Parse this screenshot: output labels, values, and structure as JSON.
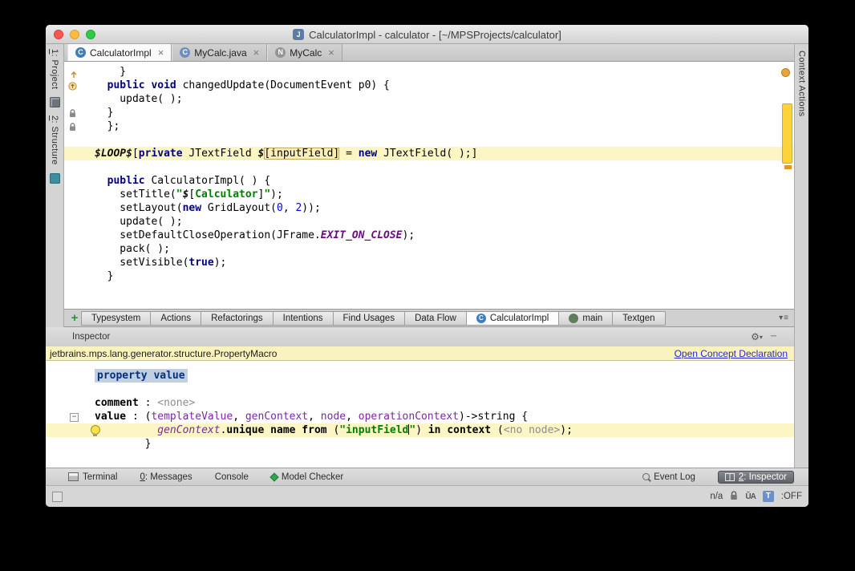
{
  "window": {
    "title": "CalculatorImpl - calculator - [~/MPSProjects/calculator]",
    "title_icon_letter": "J"
  },
  "left_stripe": {
    "items": [
      {
        "num": "1",
        "rest": ": Project"
      },
      {
        "num": "2",
        "rest": ": Structure"
      }
    ]
  },
  "right_stripe": {
    "label": "Context Actions"
  },
  "editor_tabs": [
    {
      "label": "CalculatorImpl",
      "icon": "C",
      "icon_color": "#3f7dc0",
      "icon_name": "concept-icon",
      "active": true,
      "close": "×"
    },
    {
      "label": "MyCalc.java",
      "icon": "C",
      "icon_color": "#6e8fc0",
      "icon_name": "java-class-icon",
      "active": false,
      "close": "×"
    },
    {
      "label": "MyCalc",
      "icon": "N",
      "icon_color": "#949494",
      "icon_name": "node-icon",
      "active": false,
      "close": "×"
    }
  ],
  "editor": {
    "lines": [
      {
        "tokens": [
          [
            "    }",
            "pl"
          ]
        ]
      },
      {
        "tokens": [
          [
            "  ",
            "pl"
          ],
          [
            "public",
            "kw"
          ],
          [
            " ",
            "pl"
          ],
          [
            "void",
            "kw"
          ],
          [
            " changedUpdate(DocumentEvent p0) {",
            "pl"
          ]
        ]
      },
      {
        "tokens": [
          [
            "    update( );",
            "pl"
          ]
        ]
      },
      {
        "tokens": [
          [
            "  }",
            "pl"
          ]
        ]
      },
      {
        "tokens": [
          [
            "  };",
            "pl"
          ]
        ]
      },
      {
        "tokens": []
      },
      {
        "hl": true,
        "tokens": [
          [
            "$LOOP$",
            "macro"
          ],
          [
            "[",
            "pl"
          ],
          [
            "private",
            "kw"
          ],
          [
            " JTextField ",
            "pl"
          ],
          [
            "$",
            "macro"
          ],
          [
            "[inputField]",
            "cell"
          ],
          [
            " = ",
            "pl"
          ],
          [
            "new",
            "kw"
          ],
          [
            " JTextField( );",
            "pl"
          ],
          [
            "]",
            "pl"
          ]
        ]
      },
      {
        "tokens": []
      },
      {
        "tokens": [
          [
            "  ",
            "pl"
          ],
          [
            "public",
            "kw"
          ],
          [
            " CalculatorImpl( ) {",
            "pl"
          ]
        ]
      },
      {
        "tokens": [
          [
            "    setTitle(",
            "pl"
          ],
          [
            "\"",
            "str"
          ],
          [
            "$",
            "macro"
          ],
          [
            "[",
            "pl"
          ],
          [
            "Calculator",
            "str"
          ],
          [
            "]",
            "pl"
          ],
          [
            "\"",
            "str"
          ],
          [
            ");",
            "pl"
          ]
        ]
      },
      {
        "tokens": [
          [
            "    setLayout(",
            "pl"
          ],
          [
            "new",
            "kw"
          ],
          [
            " GridLayout(",
            "pl"
          ],
          [
            "0",
            "num"
          ],
          [
            ", ",
            "pl"
          ],
          [
            "2",
            "num"
          ],
          [
            "));",
            "pl"
          ]
        ]
      },
      {
        "tokens": [
          [
            "    update( );",
            "pl"
          ]
        ]
      },
      {
        "tokens": [
          [
            "    setDefaultCloseOperation(JFrame.",
            "pl"
          ],
          [
            "EXIT_ON_CLOSE",
            "const"
          ],
          [
            ");",
            "pl"
          ]
        ]
      },
      {
        "tokens": [
          [
            "    pack( );",
            "pl"
          ]
        ]
      },
      {
        "tokens": [
          [
            "    setVisible(",
            "pl"
          ],
          [
            "true",
            "kw"
          ],
          [
            ");",
            "pl"
          ]
        ]
      },
      {
        "tokens": [
          [
            "  }",
            "pl"
          ]
        ]
      }
    ]
  },
  "bottom_tabs": {
    "add_label": "+",
    "aspect_tabs": [
      "Typesystem",
      "Actions",
      "Refactorings",
      "Intentions",
      "Find Usages",
      "Data Flow"
    ],
    "file_tabs": [
      {
        "label": "CalculatorImpl",
        "icon": "C",
        "icon_color": "#3f7dc0",
        "active": true
      },
      {
        "label": "main",
        "icon": "",
        "icon_color": "#5d7d5d",
        "active": false
      },
      {
        "label": "Textgen",
        "active": false
      }
    ]
  },
  "inspector": {
    "title": "Inspector",
    "banner_text": "jetbrains.mps.lang.generator.structure.PropertyMacro",
    "banner_link": "Open Concept Declaration",
    "lines": [
      {
        "tokens": [
          [
            "property value",
            "propsel"
          ]
        ]
      },
      {
        "tokens": []
      },
      {
        "tokens": [
          [
            "comment",
            "b"
          ],
          [
            " : ",
            "pl"
          ],
          [
            "<none>",
            "gray"
          ]
        ]
      },
      {
        "tokens": [
          [
            "value",
            "b"
          ],
          [
            " : (",
            "pl"
          ],
          [
            "templateValue",
            "param"
          ],
          [
            ", ",
            "pl"
          ],
          [
            "genContext",
            "param"
          ],
          [
            ", ",
            "pl"
          ],
          [
            "node",
            "param"
          ],
          [
            ", ",
            "pl"
          ],
          [
            "operationContext",
            "param"
          ],
          [
            ")->string {",
            "pl"
          ]
        ]
      },
      {
        "hl": true,
        "tokens": [
          [
            "          ",
            "pl"
          ],
          [
            "genContext",
            "parami"
          ],
          [
            ".",
            "pl"
          ],
          [
            "unique name from",
            "b"
          ],
          [
            " (",
            "pl"
          ],
          [
            "\"inputField",
            "str"
          ],
          [
            "",
            "caret"
          ],
          [
            "\"",
            "str"
          ],
          [
            ") ",
            "pl"
          ],
          [
            "in context",
            "b"
          ],
          [
            " (",
            "pl"
          ],
          [
            "<no node>",
            "gray"
          ],
          [
            ");",
            "pl"
          ]
        ]
      },
      {
        "tokens": [
          [
            "        }",
            "pl"
          ]
        ]
      }
    ]
  },
  "status_bar": {
    "left": [
      {
        "icon": "terminal",
        "num": "",
        "rest": "Terminal",
        "active": false
      },
      {
        "icon": "none",
        "num": "0",
        "rest": ": Messages",
        "active": false
      },
      {
        "icon": "none",
        "num": "",
        "rest": "Console",
        "active": false
      },
      {
        "icon": "gem",
        "num": "",
        "rest": "Model Checker",
        "active": false
      }
    ],
    "right": [
      {
        "icon": "search",
        "num": "",
        "rest": "Event Log",
        "active": false
      },
      {
        "icon": "inspector",
        "num": "2",
        "rest": ": Inspector",
        "active": true
      }
    ]
  },
  "bottom_bar": {
    "position": "n/a",
    "t_badge": "T",
    "t_state": ":OFF"
  }
}
